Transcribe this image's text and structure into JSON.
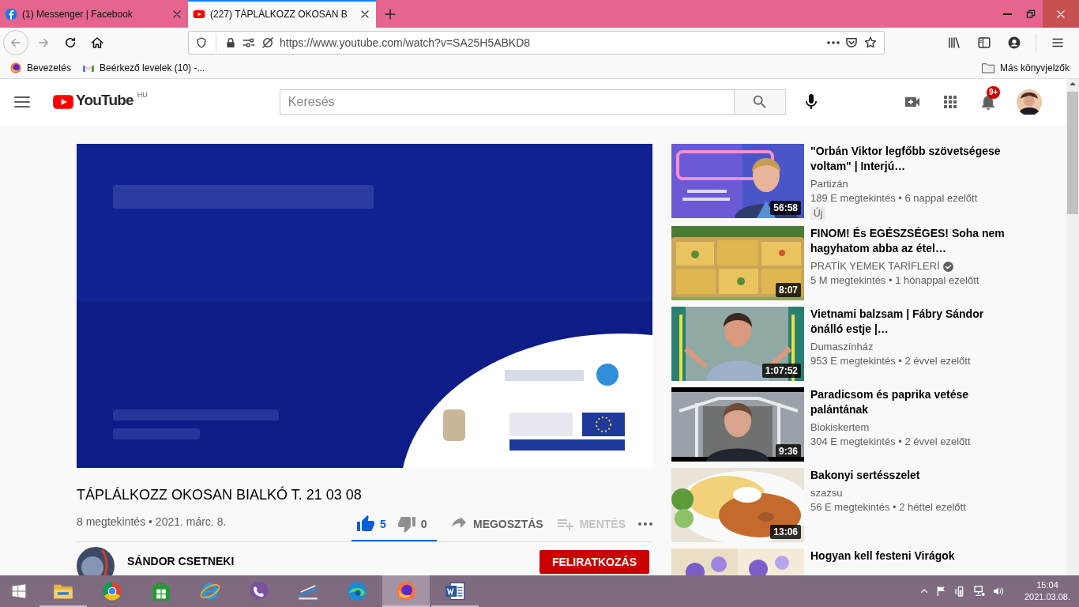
{
  "browser": {
    "tabs": [
      {
        "title": "(1) Messenger | Facebook",
        "kind": "facebook",
        "selected": false
      },
      {
        "title": "(227) TÁPLÁLKOZZ OKOSAN B",
        "kind": "youtube",
        "selected": true
      }
    ],
    "url": "https://www.youtube.com/watch?v=SA25H5ABKD8",
    "bookmarks": [
      {
        "label": "Bevezetés",
        "kind": "firefox"
      },
      {
        "label": "Beérkező levelek (10) -...",
        "kind": "gmail"
      }
    ],
    "other_bookmarks": "Más könyvjelzők"
  },
  "youtube": {
    "logo": "YouTube",
    "country": "HU",
    "search": {
      "placeholder": "Keresés"
    },
    "notifications": "9+"
  },
  "video": {
    "title": "TÁPLÁLKOZZ OKOSAN BIALKÓ T. 21 03 08",
    "meta": "8 megtekintés • 2021. márc. 8.",
    "likes": "5",
    "liked": true,
    "dislikes": "0",
    "sentiment": {
      "level": 1
    },
    "share": "MEGOSZTÁS",
    "save": {
      "label": "MENTÉS",
      "disabled": true
    },
    "channel": "SÁNDOR CSETNEKI",
    "subscribe": "FELIRATKOZÁS"
  },
  "recommended": [
    {
      "title": "\"Orbán Viktor legfőbb szövetségese voltam\" | Interjú…",
      "channel": "Partizán",
      "verified": false,
      "meta": "189 E megtekintés • 6 nappal ezelőtt",
      "badge": "Új",
      "duration": "56:58"
    },
    {
      "title": "FINOM! És EGÉSZSÉGES! Soha nem hagyhatom abba az étel…",
      "channel": "PRATİK YEMEK TARİFLERİ",
      "verified": true,
      "meta": "5 M megtekintés • 1 hónappal ezelőtt",
      "duration": "8:07"
    },
    {
      "title": "Vietnami balzsam | Fábry Sándor önálló estje |…",
      "channel": "Dumaszínház",
      "verified": false,
      "meta": "953 E megtekintés • 2 évvel ezelőtt",
      "duration": "1:07:52"
    },
    {
      "title": "Paradicsom és paprika vetése palántának",
      "channel": "Biokiskertem",
      "verified": false,
      "meta": "304 E megtekintés • 2 évvel ezelőtt",
      "duration": "9:36"
    },
    {
      "title": "Bakonyi sertésszelet",
      "channel": "szazsu",
      "verified": false,
      "meta": "56 E megtekintés • 2 héttel ezelőtt",
      "duration": "13:06"
    },
    {
      "title": "Hogyan kell festeni Virágok"
    }
  ],
  "taskbar": {
    "apps": [
      {
        "kind": "folder",
        "open": true,
        "selected": false
      },
      {
        "kind": "chrome",
        "open": false,
        "selected": false
      },
      {
        "kind": "store",
        "open": false,
        "selected": false
      },
      {
        "kind": "ie",
        "open": false,
        "selected": false
      },
      {
        "kind": "viber",
        "open": false,
        "selected": false
      },
      {
        "kind": "scanner",
        "open": false,
        "selected": false
      },
      {
        "kind": "edge",
        "open": false,
        "selected": false
      },
      {
        "kind": "firefox",
        "open": true,
        "selected": true
      },
      {
        "kind": "word",
        "open": true,
        "selected": false
      }
    ],
    "time": "15:04",
    "date": "2021.03.08."
  }
}
